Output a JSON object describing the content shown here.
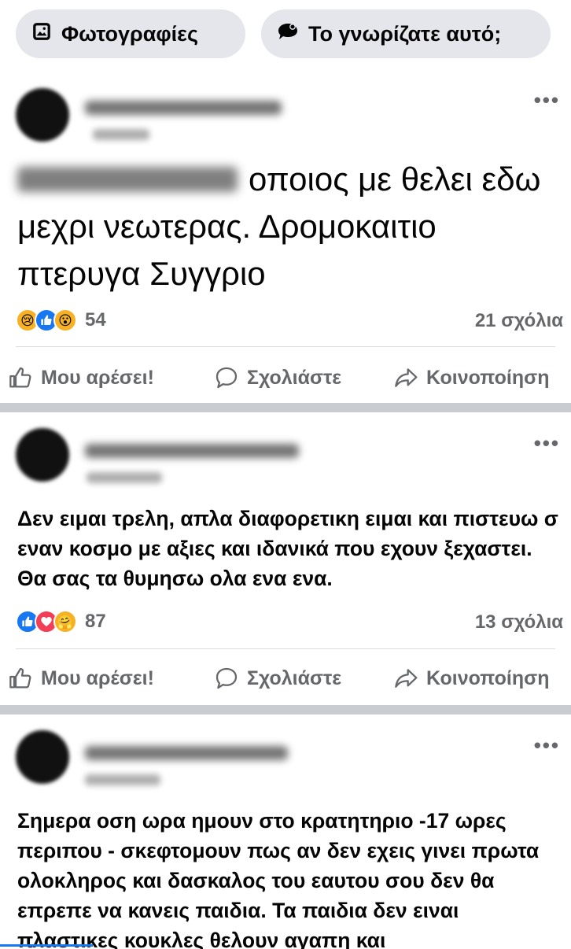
{
  "chips": [
    {
      "label": "Φωτογραφίες",
      "icon": "photo-icon"
    },
    {
      "label": "Το γνωρίζατε αυτό;",
      "icon": "speech-bubble-icon"
    }
  ],
  "labels": {
    "like": "Μου αρέσει!",
    "comment": "Σχολιάστε",
    "share": "Κοινοποίηση"
  },
  "posts": [
    {
      "text": "οποιος με θελει εδω μεχρι νεωτερας. Δρομοκαιτιο πτερυγα Συγγριο",
      "reactions": [
        "sad",
        "like",
        "wow"
      ],
      "reaction_count": "54",
      "comments": "21 σχόλια"
    },
    {
      "text": "Δεν ειμαι τρελη, απλα διαφορετικη ειμαι και πιστευω σ εναν κοσμο με αξιες και ιδανικά που εχουν ξεχαστει. Θα σας τα θυμησω ολα ενα ενα.",
      "reactions": [
        "like",
        "love",
        "care"
      ],
      "reaction_count": "87",
      "comments": "13 σχόλια"
    },
    {
      "text": "Σημερα οση ωρα ημουν στο κρατητηριο -17 ωρες περιπου - σκεφτομουν πως αν δεν εχεις γινει πρωτα ολοκληρος και δασκαλος του εαυτου σου δεν θα επρεπε να κανεις παιδια. Τα παιδια δεν ειναι πλαστικες κουκλες θελουν αγαπη και"
    }
  ],
  "colors": {
    "accent": "#1877f2",
    "secondary_text": "#65676b",
    "chip_bg": "#e4e6eb"
  }
}
